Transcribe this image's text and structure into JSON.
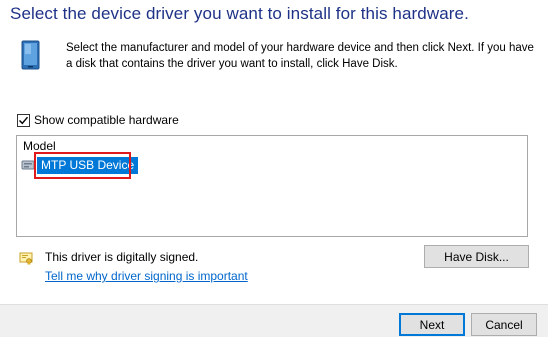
{
  "dialog": {
    "heading": "Select the device driver you want to install for this hardware.",
    "instructions": "Select the manufacturer and model of your hardware device and then click Next. If you have a disk that contains the driver you want to install, click Have Disk."
  },
  "compatible": {
    "label": "Show compatible hardware",
    "checked": true
  },
  "model_list": {
    "header": "Model",
    "items": [
      {
        "label": "MTP USB Device",
        "selected": true
      }
    ]
  },
  "signature": {
    "status_text": "This driver is digitally signed.",
    "link_text": "Tell me why driver signing is important"
  },
  "buttons": {
    "have_disk": "Have Disk...",
    "next": "Next",
    "cancel": "Cancel"
  },
  "colors": {
    "heading": "#1e3287",
    "selection": "#0078d7",
    "annotation_box": "#e0191d",
    "link": "#0066cc"
  },
  "icons": {
    "device": "device-icon",
    "list_item": "usb-device-icon",
    "signature": "certificate-icon"
  }
}
